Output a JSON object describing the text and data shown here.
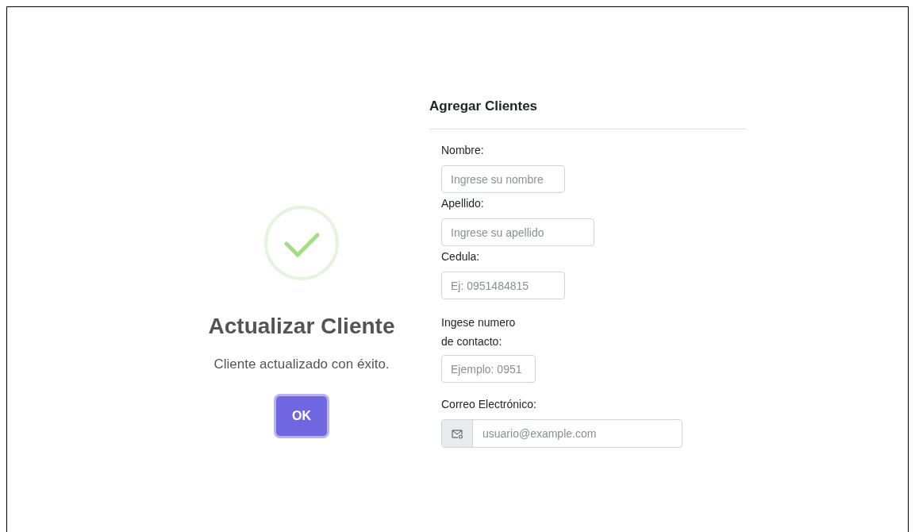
{
  "alert": {
    "title": "Actualizar Cliente",
    "message": "Cliente actualizado con éxito.",
    "button": "OK"
  },
  "form": {
    "title": "Agregar Clientes",
    "fields": [
      {
        "kind": "text",
        "label": "Nombre:",
        "placeholder": "Ingrese su nombre"
      },
      {
        "kind": "text",
        "label": "Apellido:",
        "placeholder": "Ingrese su apellido"
      },
      {
        "kind": "text",
        "label": "Cedula:",
        "placeholder": "Ej: 0951484815"
      },
      {
        "kind": "multiline",
        "label_lines": [
          "Ingese numero",
          "de contacto:"
        ],
        "placeholder": "Ejemplo: 0951"
      },
      {
        "kind": "email",
        "label": "Correo Electrónico:",
        "placeholder": "usuario@example.com"
      }
    ]
  }
}
